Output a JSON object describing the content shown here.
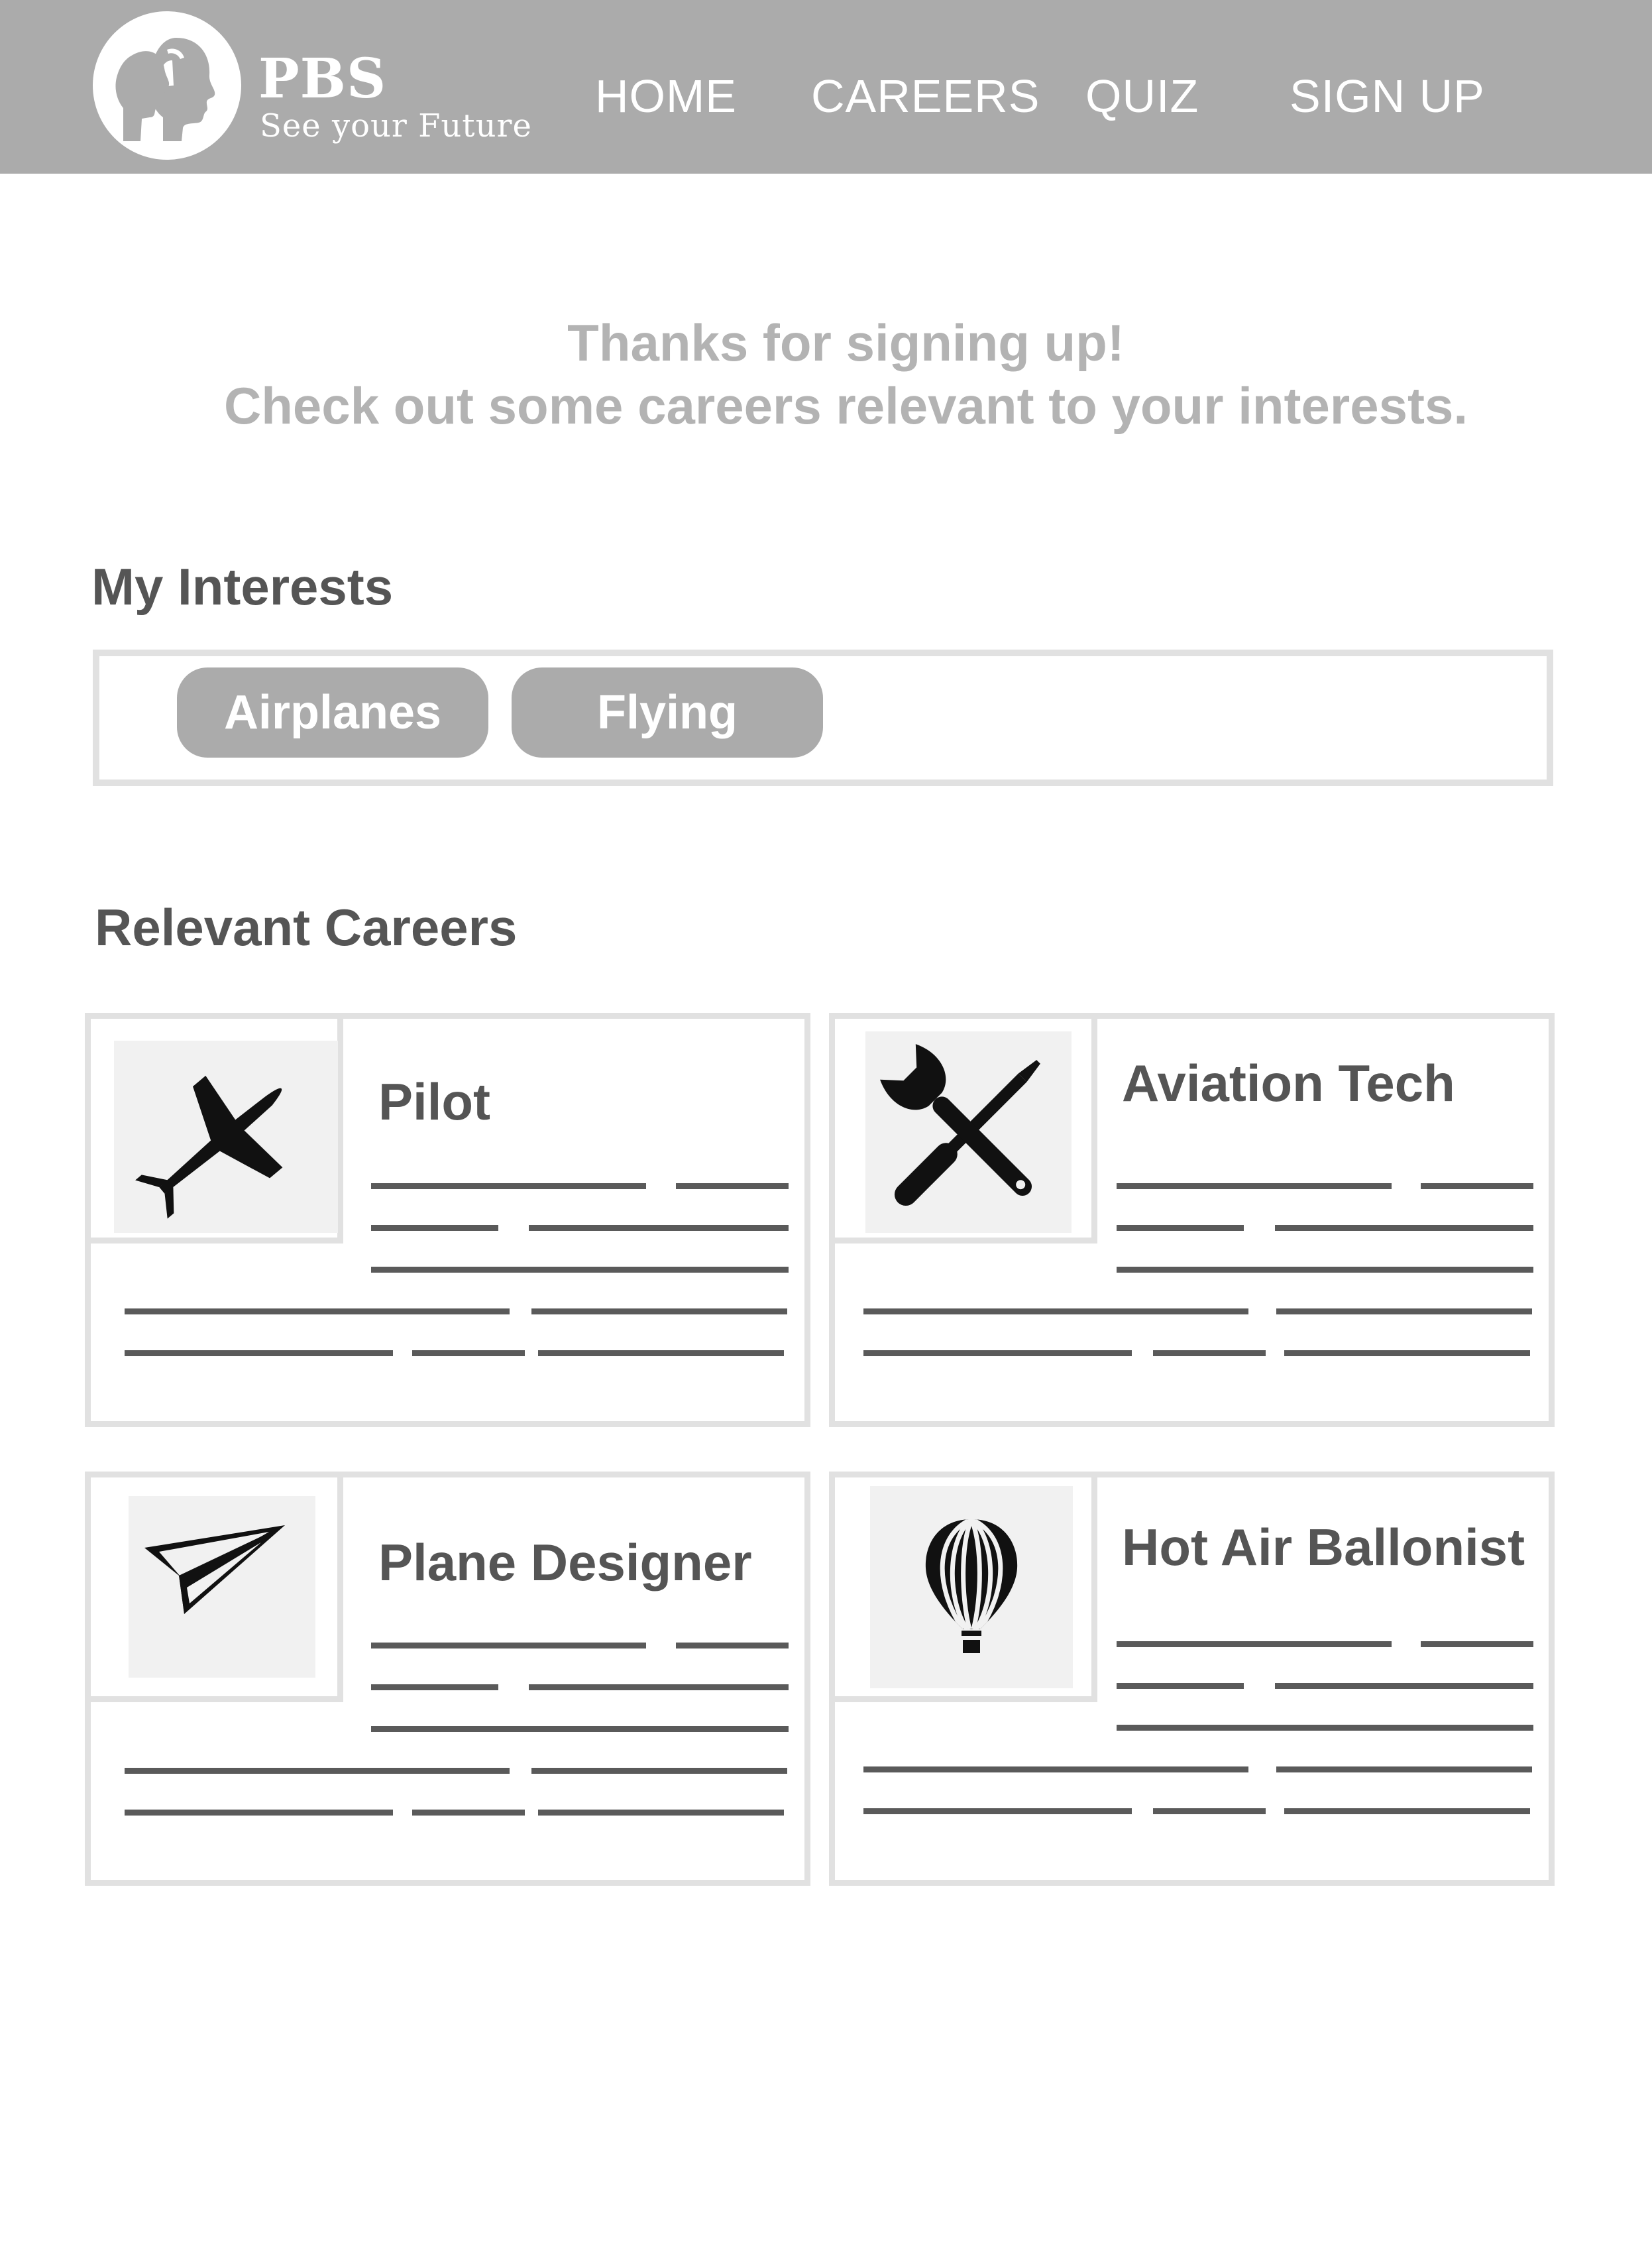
{
  "header": {
    "brand": "PBS",
    "tagline": "See your Future",
    "nav": [
      "HOME",
      "CAREERS",
      "QUIZ",
      "SIGN UP"
    ]
  },
  "intro": {
    "line1": "Thanks for signing up!",
    "line2": "Check out some careers relevant to your interests."
  },
  "interests": {
    "title": "My Interests",
    "tags": [
      "Airplanes",
      "Flying"
    ]
  },
  "careers": {
    "title": "Relevant Careers",
    "items": [
      {
        "title": "Pilot",
        "icon": "airplane-icon"
      },
      {
        "title": "Aviation Tech",
        "icon": "wrench-screwdriver-icon"
      },
      {
        "title": "Plane Designer",
        "icon": "paper-plane-icon"
      },
      {
        "title": "Hot Air Ballonist",
        "icon": "hot-air-balloon-icon"
      }
    ]
  },
  "colors": {
    "header_bg": "#ababab",
    "tag_bg": "#ababab",
    "border": "#e1e1e1",
    "heading_text": "#555555",
    "intro_text": "#b3b3b3",
    "icon_bg": "#f1f1f1"
  }
}
